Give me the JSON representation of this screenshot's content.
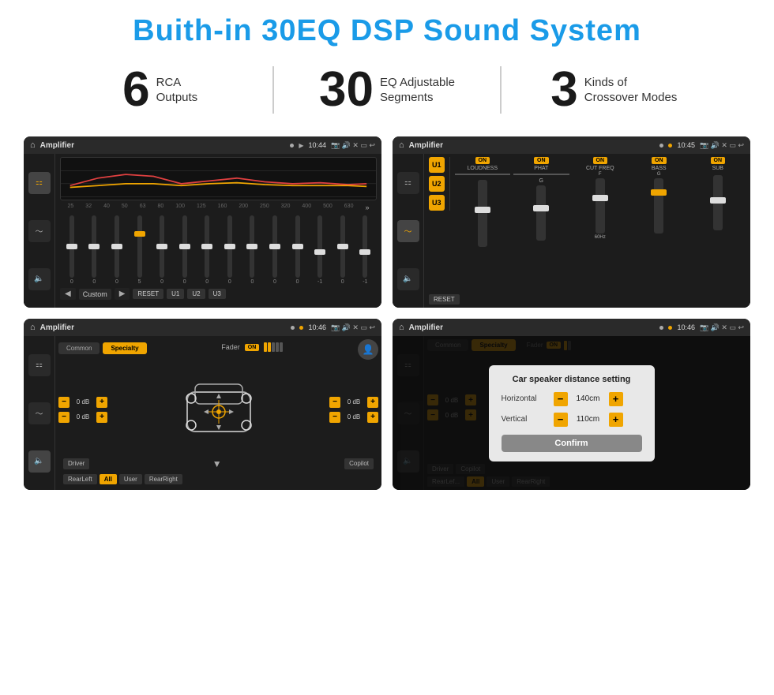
{
  "page": {
    "title": "Buith-in 30EQ DSP Sound System"
  },
  "stats": [
    {
      "number": "6",
      "text_line1": "RCA",
      "text_line2": "Outputs"
    },
    {
      "number": "30",
      "text_line1": "EQ Adjustable",
      "text_line2": "Segments"
    },
    {
      "number": "3",
      "text_line1": "Kinds of",
      "text_line2": "Crossover Modes"
    }
  ],
  "screen1": {
    "topbar": {
      "title": "Amplifier",
      "time": "10:44"
    },
    "freq_labels": [
      "25",
      "32",
      "40",
      "50",
      "63",
      "80",
      "100",
      "125",
      "160",
      "200",
      "250",
      "320",
      "400",
      "500",
      "630"
    ],
    "slider_vals": [
      "0",
      "0",
      "0",
      "5",
      "0",
      "0",
      "0",
      "0",
      "0",
      "0",
      "0",
      "-1",
      "0",
      "-1"
    ],
    "bottom_btns": [
      "Custom",
      "RESET",
      "U1",
      "U2",
      "U3"
    ]
  },
  "screen2": {
    "topbar": {
      "title": "Amplifier",
      "time": "10:45"
    },
    "presets": [
      "U1",
      "U2",
      "U3"
    ],
    "controls": [
      "LOUDNESS",
      "PHAT",
      "CUT FREQ",
      "BASS",
      "SUB"
    ],
    "reset_label": "RESET"
  },
  "screen3": {
    "topbar": {
      "title": "Amplifier",
      "time": "10:46"
    },
    "tabs": [
      "Common",
      "Specialty"
    ],
    "fader_label": "Fader",
    "db_values": [
      "0 dB",
      "0 dB",
      "0 dB",
      "0 dB"
    ],
    "bottom_btns": [
      "Driver",
      "Copilot",
      "RearLeft",
      "All",
      "User",
      "RearRight"
    ]
  },
  "screen4": {
    "topbar": {
      "title": "Amplifier",
      "time": "10:46"
    },
    "dialog": {
      "title": "Car speaker distance setting",
      "fields": [
        {
          "label": "Horizontal",
          "value": "140cm"
        },
        {
          "label": "Vertical",
          "value": "110cm"
        }
      ],
      "confirm_label": "Confirm"
    },
    "db_values": [
      "0 dB",
      "0 dB"
    ],
    "bottom_btns": [
      "Driver",
      "Copilot",
      "RearLef...",
      "User",
      "RearRight"
    ]
  },
  "icons": {
    "home": "⌂",
    "location": "📍",
    "volume": "🔊",
    "settings": "⚙",
    "back": "↩",
    "play": "▶",
    "prev": "◀",
    "eq": "≡",
    "wave": "〜",
    "speaker": "🔈"
  }
}
